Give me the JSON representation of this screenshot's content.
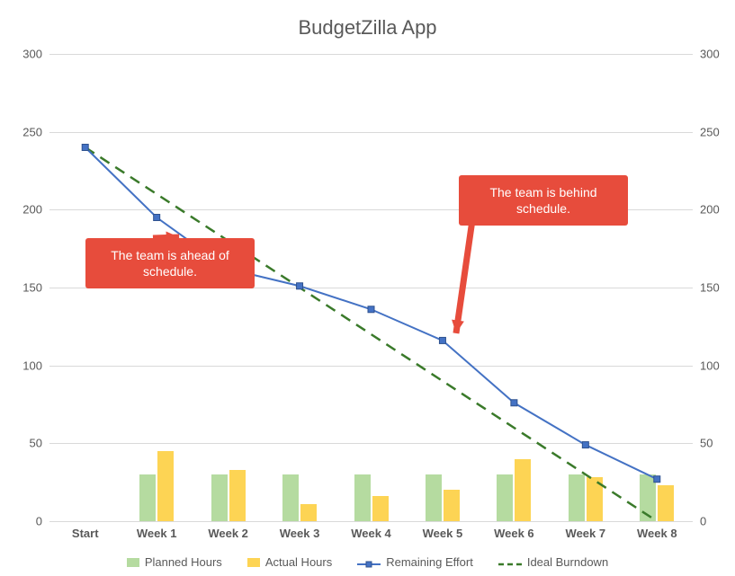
{
  "chart_data": {
    "type": "bar",
    "title": "BudgetZilla App",
    "categories": [
      "Start",
      "Week 1",
      "Week 2",
      "Week 3",
      "Week 4",
      "Week 5",
      "Week 6",
      "Week 7",
      "Week 8"
    ],
    "series": [
      {
        "name": "Planned Hours",
        "kind": "bar",
        "color": "#b5dba0",
        "values": [
          0,
          30,
          30,
          30,
          30,
          30,
          30,
          30,
          30
        ]
      },
      {
        "name": "Actual Hours",
        "kind": "bar",
        "color": "#fdd454",
        "values": [
          0,
          45,
          33,
          11,
          16,
          20,
          40,
          28,
          23
        ]
      },
      {
        "name": "Remaining Effort",
        "kind": "line",
        "color": "#4472c4",
        "values": [
          240,
          195,
          162,
          151,
          136,
          116,
          76,
          49,
          27
        ]
      },
      {
        "name": "Ideal Burndown",
        "kind": "line_dashed",
        "color": "#3a7a2a",
        "values": [
          240,
          210,
          180,
          150,
          120,
          90,
          60,
          30,
          0
        ]
      }
    ],
    "ylim": [
      0,
      300
    ],
    "yticks": [
      0,
      50,
      100,
      150,
      200,
      250,
      300
    ],
    "annotations": [
      {
        "text": "The team is ahead of schedule.",
        "target_category": "Week 1"
      },
      {
        "text": "The team is behind schedule.",
        "target_category": "Week 5"
      }
    ],
    "legend": [
      "Planned Hours",
      "Actual Hours",
      "Remaining Effort",
      "Ideal Burndown"
    ]
  }
}
